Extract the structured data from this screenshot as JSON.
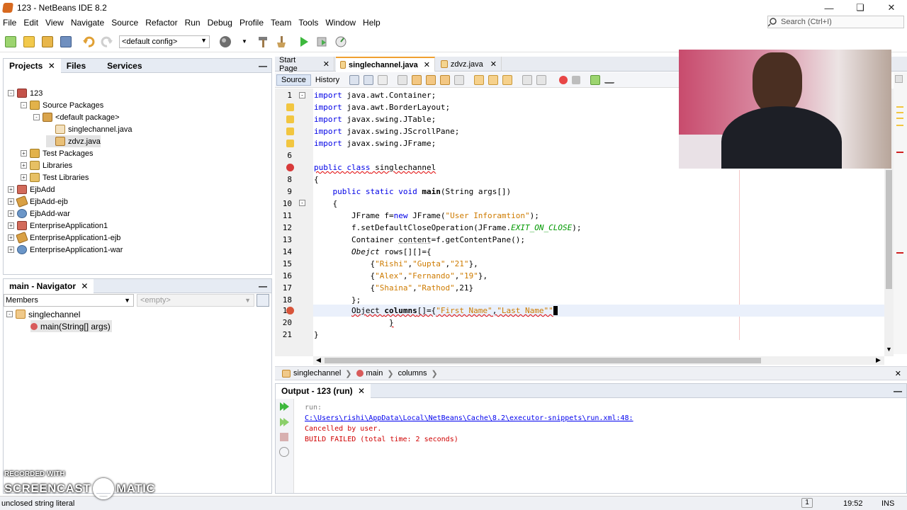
{
  "window": {
    "title": "123 - NetBeans IDE 8.2"
  },
  "menu": [
    "File",
    "Edit",
    "View",
    "Navigate",
    "Source",
    "Refactor",
    "Run",
    "Debug",
    "Profile",
    "Team",
    "Tools",
    "Window",
    "Help"
  ],
  "search": {
    "placeholder": "Search (Ctrl+I)"
  },
  "toolbar": {
    "config": "<default config>"
  },
  "projects": {
    "tabs": [
      "Projects",
      "Files",
      "Services"
    ],
    "tree": [
      {
        "label": "123",
        "indent": 0,
        "exp": "-",
        "icon": "coffee"
      },
      {
        "label": "Source Packages",
        "indent": 1,
        "exp": "-",
        "icon": "pkgfolder"
      },
      {
        "label": "<default package>",
        "indent": 2,
        "exp": "-",
        "icon": "package"
      },
      {
        "label": "singlechannel.java",
        "indent": 3,
        "exp": "",
        "icon": "java"
      },
      {
        "label": "zdvz.java",
        "indent": 3,
        "exp": "",
        "icon": "javaerr"
      },
      {
        "label": "Test Packages",
        "indent": 1,
        "exp": "+",
        "icon": "pkgfolder"
      },
      {
        "label": "Libraries",
        "indent": 1,
        "exp": "+",
        "icon": "folder"
      },
      {
        "label": "Test Libraries",
        "indent": 1,
        "exp": "+",
        "icon": "folder"
      },
      {
        "label": "EjbAdd",
        "indent": 0,
        "exp": "+",
        "icon": "ear"
      },
      {
        "label": "EjbAdd-ejb",
        "indent": 0,
        "exp": "+",
        "icon": "bean"
      },
      {
        "label": "EjbAdd-war",
        "indent": 0,
        "exp": "+",
        "icon": "globe"
      },
      {
        "label": "EnterpriseApplication1",
        "indent": 0,
        "exp": "+",
        "icon": "ear"
      },
      {
        "label": "EnterpriseApplication1-ejb",
        "indent": 0,
        "exp": "+",
        "icon": "bean"
      },
      {
        "label": "EnterpriseApplication1-war",
        "indent": 0,
        "exp": "+",
        "icon": "globe"
      }
    ]
  },
  "navigator": {
    "title": "main - Navigator",
    "members": "Members",
    "empty": "<empty>",
    "tree": [
      {
        "label": "singlechannel",
        "indent": 0
      },
      {
        "label": "main(String[] args)",
        "indent": 1
      }
    ]
  },
  "editor": {
    "tabs": [
      "Start Page",
      "singlechannel.java",
      "zdvz.java"
    ],
    "modes": [
      "Source",
      "History"
    ],
    "lines": [
      "1",
      "2",
      "3",
      "4",
      "5",
      "6",
      "7",
      "8",
      "9",
      "10",
      "11",
      "12",
      "13",
      "14",
      "15",
      "16",
      "17",
      "18",
      "19",
      "20",
      "21"
    ],
    "breadcrumb": [
      "singlechannel",
      "main",
      "columns"
    ]
  },
  "output": {
    "title": "Output - 123 (run)",
    "lines": [
      {
        "text": "run:",
        "color": "#808080"
      },
      {
        "text": "C:\\Users\\rishi\\AppData\\Local\\NetBeans\\Cache\\8.2\\executor-snippets\\run.xml:48:",
        "color": "#0000ee"
      },
      {
        "text": "Cancelled by user.",
        "color": "#d00000"
      },
      {
        "text": "BUILD FAILED (total time: 2 seconds)",
        "color": "#d00000"
      }
    ]
  },
  "status": {
    "message": "unclosed string literal",
    "time": "19:52",
    "notifications": "1",
    "position": "INS"
  },
  "watermark": {
    "line1": "RECORDED WITH",
    "line2": "SCREENCAST",
    "line3": "MATIC"
  }
}
